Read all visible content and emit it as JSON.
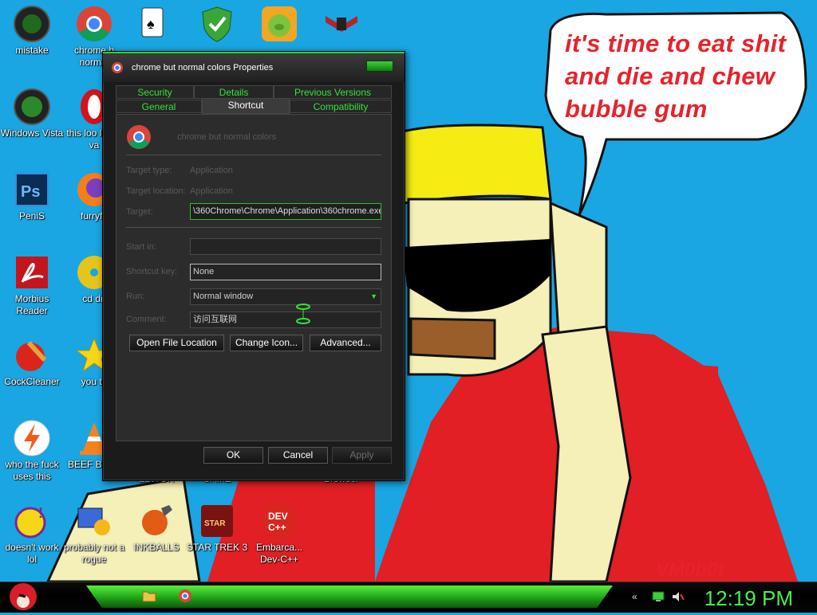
{
  "speech_lines": [
    "it's time to eat shit",
    "and die and chew",
    "bubble gum"
  ],
  "signature": "VM0b0t",
  "desktop_icons": {
    "mistake": "mistake",
    "chrome_normal": "chrome b normal",
    "windows_vista": "Windows Vista",
    "this_looks": "this loo like a va",
    "penis": "PeniS",
    "furryfox": "furryfo",
    "morbius": "Morbius Reader",
    "cd_drive": "cd dri",
    "cockcleaner": "CockCleaner",
    "you_tried": "you tri",
    "who_the_fuck": "who the fuck uses this",
    "beef": "BEEF BEEF",
    "editor": "EDITOR",
    "game": "GAME",
    "browser": "Browser",
    "doesnt_work": "doesn't work lol",
    "probably_not": "probably not a rogue",
    "inkballs": "INKBALLS",
    "star_trek": "STAR TREK 3",
    "embarcadero": "Embarca... Dev-C++"
  },
  "window": {
    "title": "chrome but normal colors Properties",
    "tabs_row1": [
      "Security",
      "Details",
      "Previous Versions"
    ],
    "tabs_row2": [
      "General",
      "Shortcut",
      "Compatibility"
    ],
    "active_tab": "Shortcut",
    "shortcut_name": "chrome but normal colors",
    "labels": {
      "target_type": "Target type:",
      "target_location": "Target location:",
      "target": "Target:",
      "start_in": "Start in:",
      "shortcut_key": "Shortcut key:",
      "run": "Run:",
      "comment": "Comment:"
    },
    "values": {
      "target_type": "Application",
      "target_location": "Application",
      "target": "\\360Chrome\\Chrome\\Application\\360chrome.exe",
      "start_in": "",
      "shortcut_key": "None",
      "run": "Normal window",
      "comment": "访问互联网"
    },
    "buttons": {
      "open_file_location": "Open File Location",
      "change_icon": "Change Icon...",
      "advanced": "Advanced...",
      "ok": "OK",
      "cancel": "Cancel",
      "apply": "Apply"
    }
  },
  "taskbar": {
    "clock": "12:19 PM",
    "accent": "#49f04a"
  },
  "icons": {
    "start": "angry-bird-icon",
    "taskbar_pinned": [
      "folder-icon",
      "chrome-icon"
    ],
    "tray": [
      "chevron-icon",
      "network-icon",
      "volume-muted-icon"
    ]
  }
}
